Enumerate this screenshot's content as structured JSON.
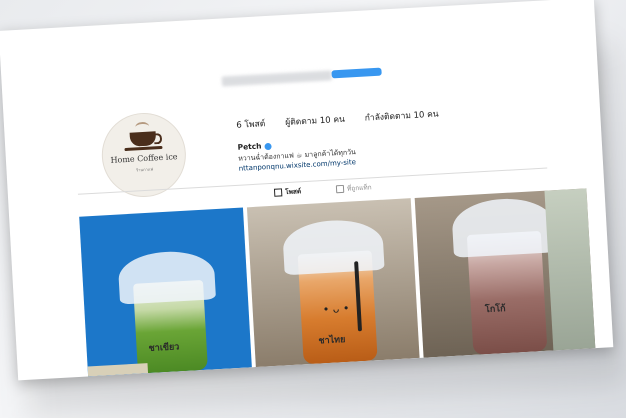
{
  "profile": {
    "brand_name": "Home Coffee ice",
    "brand_sub": "ร้านกาแฟ",
    "posts": "6 โพสต์",
    "followers": "ผู้ติดตาม 10 คน",
    "following": "กำลังติดตาม 10 คน",
    "name": "Petch",
    "bio": "หวานฉ่ำต้องกาแฟ ☕ มาลูกค้าได้ทุกวัน",
    "link": "nttanponqnu.wixsite.com/my-site"
  },
  "tabs": {
    "posts": "โพสต์",
    "tagged": "ที่ถูกแท็ก"
  },
  "photos": [
    {
      "cup_label": "ชาเขียว"
    },
    {
      "cup_label": "ชาไทย"
    },
    {
      "cup_label": "โกโก้"
    }
  ],
  "colors": {
    "accent": "#3897f0",
    "photo1_bg": "#1c77c9"
  }
}
